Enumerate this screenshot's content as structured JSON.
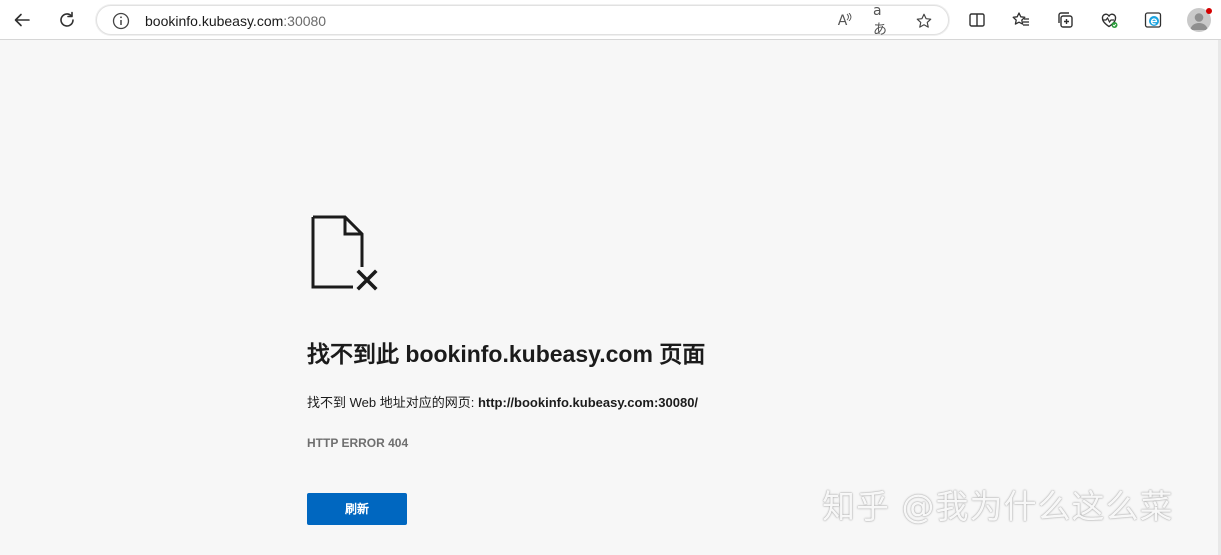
{
  "browser": {
    "address": {
      "host": "bookinfo.kubeasy.com",
      "port": ":30080"
    },
    "read_aloud_glyph": "A",
    "translate_glyph": "aあ",
    "icons": [
      "back-icon",
      "refresh-icon",
      "info-icon",
      "read-aloud-icon",
      "translate-icon",
      "favorite-star-icon",
      "split-screen-icon",
      "favorites-icon",
      "collections-icon",
      "browser-essentials-icon",
      "edge-icon",
      "profile-avatar"
    ]
  },
  "error_page": {
    "title": "找不到此 bookinfo.kubeasy.com 页面",
    "description_prefix": "找不到 Web 地址对应的网页: ",
    "description_url": "http://bookinfo.kubeasy.com:30080/",
    "error_code": "HTTP ERROR 404",
    "refresh_label": "刷新"
  },
  "watermark": "知乎 @我为什么这么菜",
  "colors": {
    "page_background": "#f7f7f7",
    "button_blue": "#0067c0",
    "profile_badge": "#d40000"
  }
}
